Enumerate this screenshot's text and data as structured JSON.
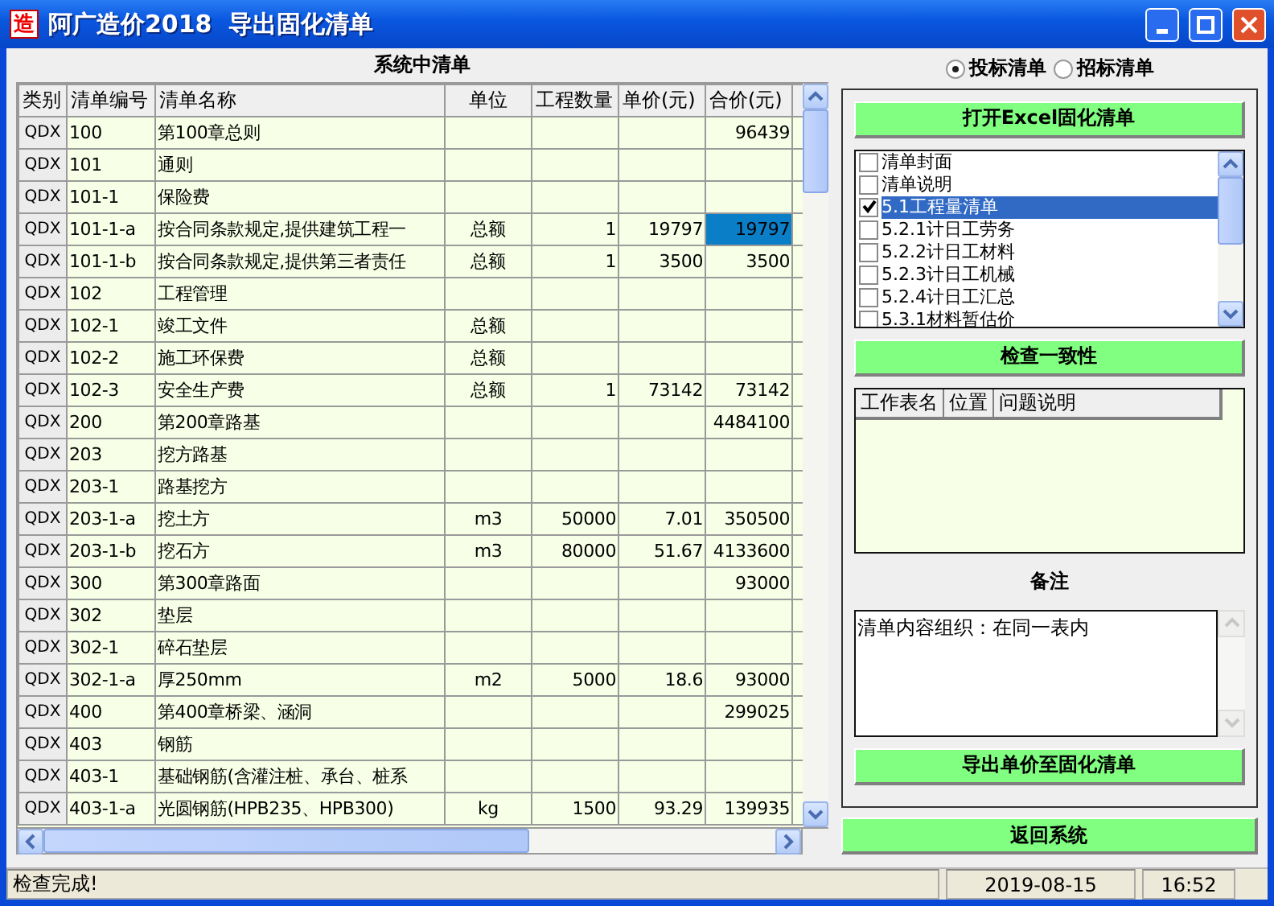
{
  "window": {
    "icon_text": "造",
    "title": "阿广造价2018  导出固化清单"
  },
  "left_panel": {
    "title": "系统中清单",
    "table": {
      "columns": [
        "类别",
        "清单编号",
        "清单名称",
        "单位",
        "工程数量",
        "单价(元)",
        "合价(元)"
      ],
      "rows": [
        {
          "cells": [
            "QDX",
            "100",
            "第100章总则",
            "",
            "",
            "",
            "96439"
          ],
          "selected": false
        },
        {
          "cells": [
            "QDX",
            "101",
            "通则",
            "",
            "",
            "",
            ""
          ],
          "selected": false
        },
        {
          "cells": [
            "QDX",
            "101-1",
            "保险费",
            "",
            "",
            "",
            ""
          ],
          "selected": false
        },
        {
          "cells": [
            "QDX",
            "101-1-a",
            "按合同条款规定,提供建筑工程一",
            "总额",
            "1",
            "19797",
            "19797"
          ],
          "selected": true
        },
        {
          "cells": [
            "QDX",
            "101-1-b",
            "按合同条款规定,提供第三者责任",
            "总额",
            "1",
            "3500",
            "3500"
          ],
          "selected": false
        },
        {
          "cells": [
            "QDX",
            "102",
            "工程管理",
            "",
            "",
            "",
            ""
          ],
          "selected": false
        },
        {
          "cells": [
            "QDX",
            "102-1",
            "竣工文件",
            "总额",
            "",
            "",
            ""
          ],
          "selected": false
        },
        {
          "cells": [
            "QDX",
            "102-2",
            "施工环保费",
            "总额",
            "",
            "",
            ""
          ],
          "selected": false
        },
        {
          "cells": [
            "QDX",
            "102-3",
            "安全生产费",
            "总额",
            "1",
            "73142",
            "73142"
          ],
          "selected": false
        },
        {
          "cells": [
            "QDX",
            "200",
            "第200章路基",
            "",
            "",
            "",
            "4484100"
          ],
          "selected": false
        },
        {
          "cells": [
            "QDX",
            "203",
            "挖方路基",
            "",
            "",
            "",
            ""
          ],
          "selected": false
        },
        {
          "cells": [
            "QDX",
            "203-1",
            "路基挖方",
            "",
            "",
            "",
            ""
          ],
          "selected": false
        },
        {
          "cells": [
            "QDX",
            "203-1-a",
            "挖土方",
            "m3",
            "50000",
            "7.01",
            "350500"
          ],
          "selected": false
        },
        {
          "cells": [
            "QDX",
            "203-1-b",
            "挖石方",
            "m3",
            "80000",
            "51.67",
            "4133600"
          ],
          "selected": false
        },
        {
          "cells": [
            "QDX",
            "300",
            "第300章路面",
            "",
            "",
            "",
            "93000"
          ],
          "selected": false
        },
        {
          "cells": [
            "QDX",
            "302",
            "垫层",
            "",
            "",
            "",
            ""
          ],
          "selected": false
        },
        {
          "cells": [
            "QDX",
            "302-1",
            "碎石垫层",
            "",
            "",
            "",
            ""
          ],
          "selected": false
        },
        {
          "cells": [
            "QDX",
            "302-1-a",
            "厚250mm",
            "m2",
            "5000",
            "18.6",
            "93000"
          ],
          "selected": false
        },
        {
          "cells": [
            "QDX",
            "400",
            "第400章桥梁、涵洞",
            "",
            "",
            "",
            "299025"
          ],
          "selected": false
        },
        {
          "cells": [
            "QDX",
            "403",
            "钢筋",
            "",
            "",
            "",
            ""
          ],
          "selected": false
        },
        {
          "cells": [
            "QDX",
            "403-1",
            "基础钢筋(含灌注桩、承台、桩系",
            "",
            "",
            "",
            ""
          ],
          "selected": false
        },
        {
          "cells": [
            "QDX",
            "403-1-a",
            "光圆钢筋(HPB235、HPB300)",
            "kg",
            "1500",
            "93.29",
            "139935"
          ],
          "selected": false
        }
      ]
    }
  },
  "right_panel": {
    "radios": [
      {
        "label": "投标清单",
        "selected": true
      },
      {
        "label": "招标清单",
        "selected": false
      }
    ],
    "open_button": "打开Excel固化清单",
    "sheets": [
      {
        "label": "清单封面",
        "checked": false,
        "selected": false
      },
      {
        "label": "清单说明",
        "checked": false,
        "selected": false
      },
      {
        "label": "5.1工程量清单",
        "checked": true,
        "selected": true
      },
      {
        "label": "5.2.1计日工劳务",
        "checked": false,
        "selected": false
      },
      {
        "label": "5.2.2计日工材料",
        "checked": false,
        "selected": false
      },
      {
        "label": "5.2.3计日工机械",
        "checked": false,
        "selected": false
      },
      {
        "label": "5.2.4计日工汇总",
        "checked": false,
        "selected": false
      },
      {
        "label": "5.3.1材料暂估价",
        "checked": false,
        "selected": false
      }
    ],
    "check_button": "检查一致性",
    "problems": {
      "columns": [
        "工作表名",
        "位置",
        "问题说明"
      ]
    },
    "notes_label": "备注",
    "notes": "清单内容组织：在同一表内",
    "export_button": "导出单价至固化清单"
  },
  "return_button": "返回系统",
  "status_bar": {
    "message": "检查完成!",
    "date": "2019-08-15",
    "time": "16:52"
  }
}
